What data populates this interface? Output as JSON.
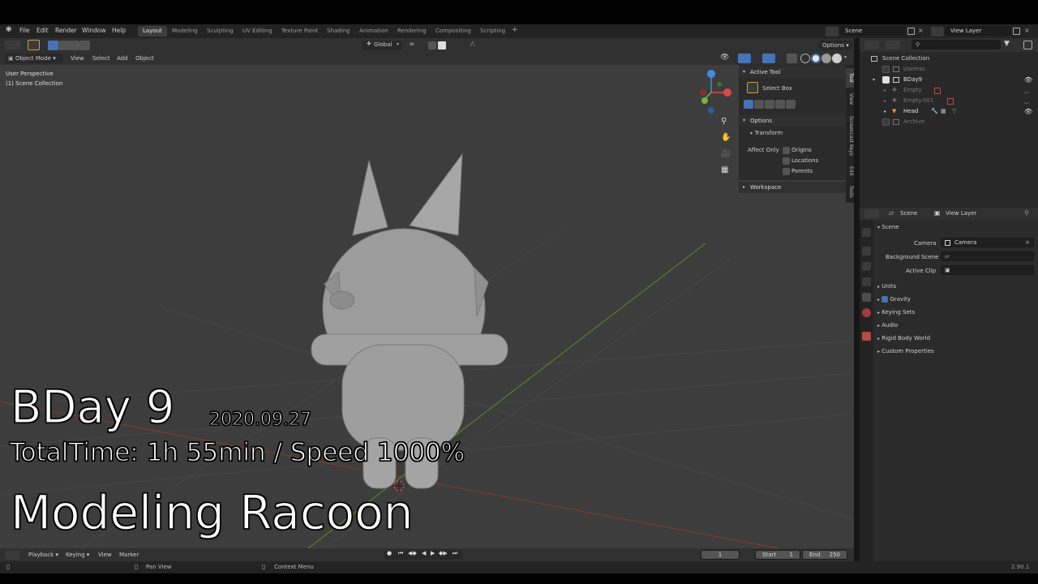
{
  "app": {
    "menu": [
      "File",
      "Edit",
      "Render",
      "Window",
      "Help"
    ],
    "workspaces": [
      "Layout",
      "Modeling",
      "Sculpting",
      "UV Editing",
      "Texture Paint",
      "Shading",
      "Animation",
      "Rendering",
      "Compositing",
      "Scripting"
    ],
    "add_tab": "+",
    "scene_name": "Scene",
    "view_layer": "View Layer",
    "version": "2.90.1"
  },
  "viewport": {
    "mode": "Object Mode",
    "menus": [
      "View",
      "Select",
      "Add",
      "Object"
    ],
    "orientation": "Global",
    "options_label": "Options",
    "perspective": "User Perspective",
    "collection": "(1) Scene Collection"
  },
  "npanel": {
    "active_tool_title": "Active Tool",
    "tool_name": "Select Box",
    "options_title": "Options",
    "transform_title": "Transform",
    "affect_only": "Affect Only",
    "checks": [
      "Origins",
      "Locations",
      "Parents"
    ],
    "workspace_title": "Workspace",
    "tabs": [
      "Tool",
      "View",
      "Screencast Keys",
      "Edit",
      "Tools"
    ]
  },
  "outliner": {
    "root": "Scene Collection",
    "rows": [
      {
        "name": "Useless",
        "dim": true,
        "level": 1
      },
      {
        "name": "BDay9",
        "dim": false,
        "level": 1
      },
      {
        "name": "Empty",
        "dim": true,
        "level": 2
      },
      {
        "name": "Empty.001",
        "dim": true,
        "level": 2
      },
      {
        "name": "Head",
        "dim": false,
        "level": 2
      },
      {
        "name": "Archive",
        "dim": true,
        "level": 1
      }
    ]
  },
  "properties": {
    "scene_label": "Scene",
    "view_layer_label": "View Layer",
    "section": "Scene",
    "camera_label": "Camera",
    "camera_value": "Camera",
    "background_label": "Background Scene",
    "clip_label": "Active Clip",
    "subsections": [
      "Units",
      "Gravity",
      "Keying Sets",
      "Audio",
      "Rigid Body World",
      "Custom Properties"
    ]
  },
  "timeline": {
    "menus": [
      "Playback",
      "Keying",
      "View",
      "Marker"
    ],
    "current_frame": "1",
    "start_label": "Start",
    "start_value": "1",
    "end_label": "End",
    "end_value": "250"
  },
  "statusbar": {
    "pan_view": "Pan View",
    "context_menu": "Context Menu"
  },
  "caption": {
    "title": "BDay 9",
    "date": "2020.09.27",
    "total_time": "TotalTime: 1h 55min / Speed 1000%",
    "subject": "Modeling Racoon"
  }
}
